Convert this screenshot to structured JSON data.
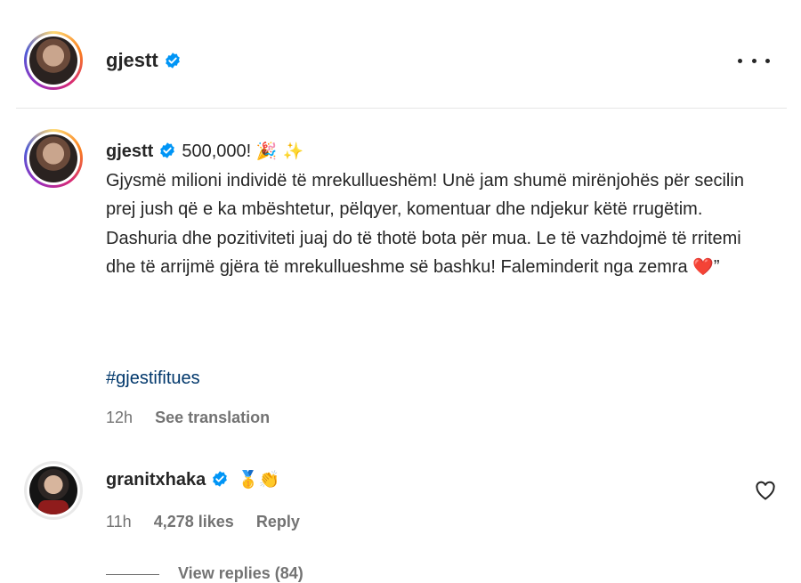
{
  "post": {
    "username": "gjestt",
    "caption_prefix": "500,000!",
    "caption_emoji": "🎉 ✨",
    "caption_body": "Gjysmë milioni individë të mrekullueshëm! Unë jam shumë mirënjohës për secilin prej jush që e ka mbështetur, pëlqyer, komentuar dhe ndjekur këtë rrugëtim. Dashuria dhe pozitiviteti juaj do të thotë bota për mua. Le të vazhdojmë të rritemi dhe të arrijmë gjëra të mrekullueshme së bashku! Faleminderit nga zemra",
    "caption_heart": "❤️",
    "caption_suffix": "”",
    "hashtag": "#gjestifitues",
    "time": "12h",
    "see_translation": "See translation"
  },
  "comment": {
    "username": "granitxhaka",
    "emoji": "🥇👏",
    "time": "11h",
    "likes": "4,278 likes",
    "reply": "Reply",
    "view_replies": "View replies (84)"
  },
  "colors": {
    "verified": "#0095f6",
    "link": "#00376b",
    "muted": "#737373"
  },
  "icons": [
    "verified-badge-icon",
    "more-options-icon",
    "heart-icon"
  ]
}
